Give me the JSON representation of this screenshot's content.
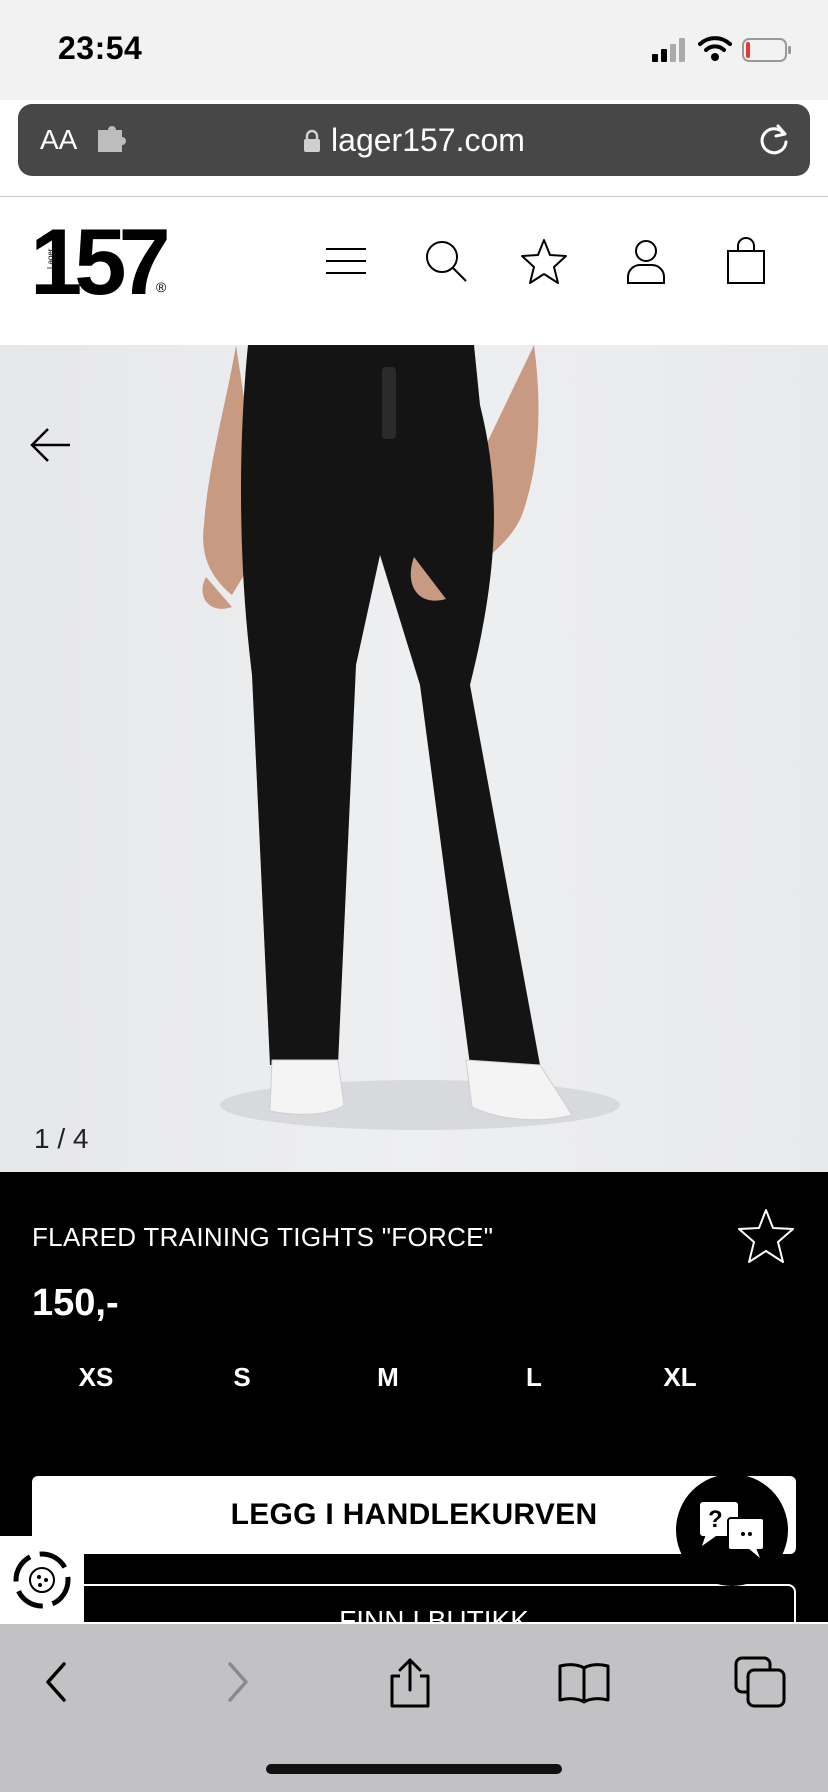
{
  "status_bar": {
    "time": "23:54"
  },
  "browser": {
    "text_size_label": "AA",
    "url": "lager157.com"
  },
  "site": {
    "logo": "157",
    "logo_sub": "Lager",
    "logo_reg": "®"
  },
  "gallery": {
    "counter": "1 / 4"
  },
  "product": {
    "title": "FLARED TRAINING TIGHTS \"FORCE\"",
    "price": "150,-",
    "sizes": [
      "XS",
      "S",
      "M",
      "L",
      "XL"
    ],
    "add_to_cart_label": "LEGG I HANDLEKURVEN",
    "find_in_store_label": "FINN I BUTIKK"
  },
  "chat": {
    "label": "?"
  },
  "colors": {
    "status_bar_bg": "#f2f2f2",
    "url_bar_bg": "#474747",
    "product_panel_bg": "#000000",
    "toolbar_bg": "#c2c2c4"
  },
  "icons": {
    "header": [
      "menu-icon",
      "search-icon",
      "wishlist-star-icon",
      "account-icon",
      "cart-bag-icon"
    ],
    "toolbar": [
      "back-icon",
      "forward-icon",
      "share-icon",
      "bookmarks-icon",
      "tabs-icon"
    ]
  }
}
